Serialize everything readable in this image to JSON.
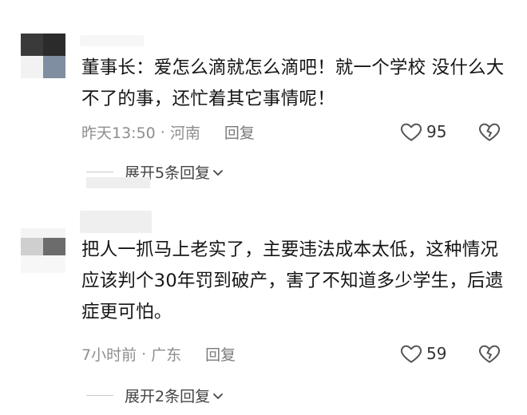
{
  "comments": [
    {
      "text": "董事长：爱怎么滴就怎么滴吧！就一个学校 没什么大不了的事，还忙着其它事情呢！",
      "time": "昨天13:50",
      "location": "河南",
      "reply_label": "回复",
      "likes": "95",
      "expand_label": "展开5条回复",
      "like_icon": "heart-outline-icon",
      "dislike_icon": "broken-heart-icon",
      "expand_icon": "chevron-down-icon"
    },
    {
      "text": "把人一抓马上老实了，主要违法成本太低，这种情况应该判个30年罚到破产，害了不知道多少学生，后遗症更可怕。",
      "time": "7小时前",
      "location": "广东",
      "reply_label": "回复",
      "likes": "59",
      "expand_label": "展开2条回复",
      "like_icon": "heart-outline-icon",
      "dislike_icon": "broken-heart-icon",
      "expand_icon": "chevron-down-icon"
    }
  ],
  "separator": "·",
  "colors": {
    "text": "#161616",
    "meta": "#8e8e8e",
    "icon": "#555555"
  }
}
